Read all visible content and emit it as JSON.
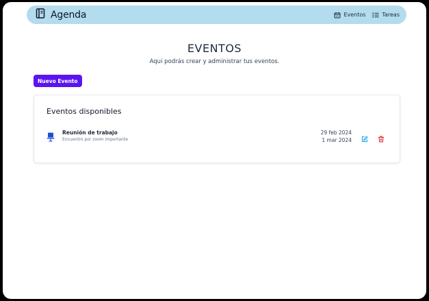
{
  "app": {
    "title": "Agenda"
  },
  "nav": {
    "eventos_label": "Eventos",
    "tareas_label": "Tareas"
  },
  "page": {
    "title": "EVENTOS",
    "subtitle": "Aqui podrás crear y administrar tus eventos.",
    "new_button_label": "Nuevo Evento"
  },
  "card": {
    "title": "Eventos disponibles",
    "events": [
      {
        "name": "Reunión de trabajo",
        "description": "Encuentro por zoom importante",
        "start_date": "29 feb 2024",
        "end_date": "1 mar 2024"
      }
    ]
  },
  "colors": {
    "navbar_bg": "#b3dcee",
    "primary_button": "#5b14f0",
    "event_icon": "#1d4ed8",
    "edit_icon": "#0ea5e9",
    "delete_icon": "#dc2626"
  },
  "icons": {
    "brand": "notebook-icon",
    "eventos": "calendar-icon",
    "tareas": "list-icon",
    "event": "presentation-icon",
    "edit": "edit-icon",
    "delete": "trash-icon"
  }
}
